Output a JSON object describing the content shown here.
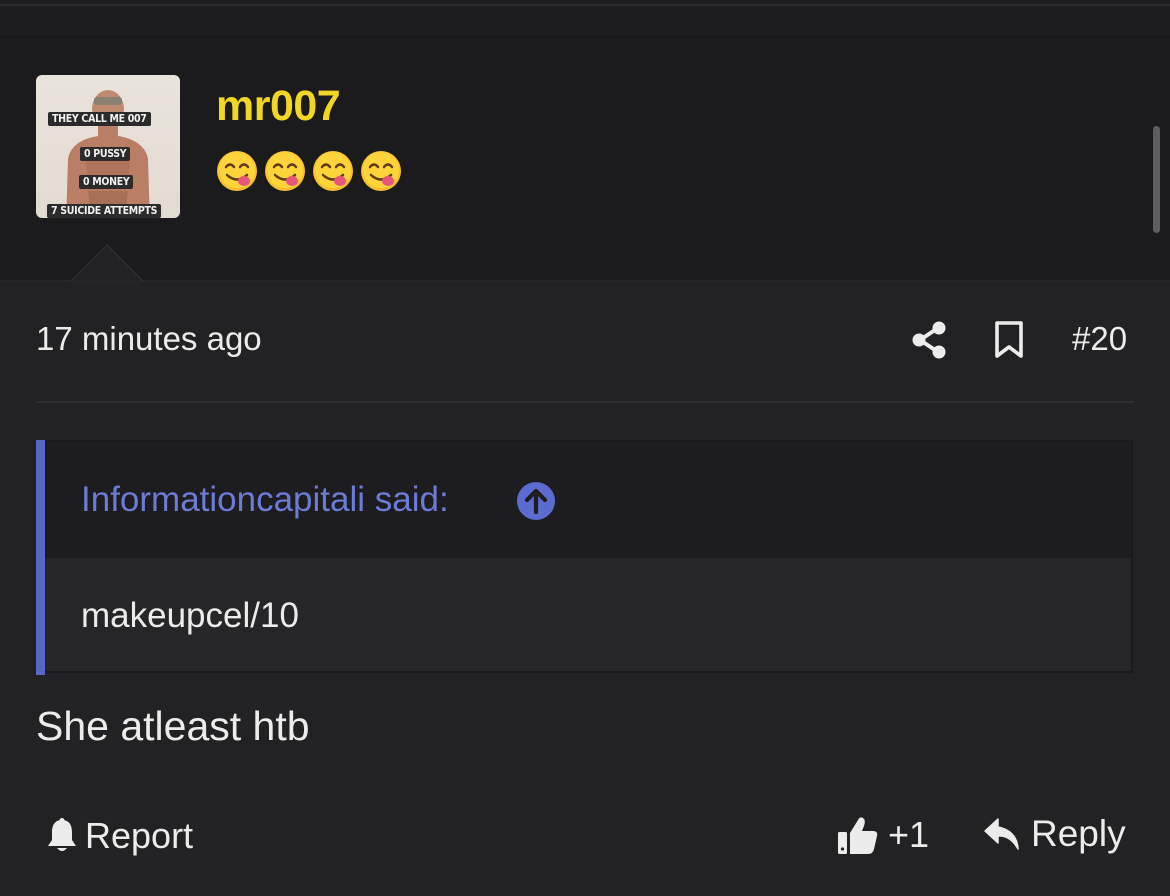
{
  "post": {
    "avatar": {
      "captions": [
        "THEY CALL ME 007",
        "0 PUSSY",
        "0 MONEY",
        "7 SUICIDE ATTEMPTS"
      ]
    },
    "username": "mr007",
    "user_title_emoji": [
      "😋",
      "😋",
      "😋",
      "😋"
    ],
    "timestamp": "17 minutes ago",
    "post_number": "#20",
    "quote": {
      "author": "Informationcapitali said:",
      "text": "makeupcel/10"
    },
    "body": "She atleast htb",
    "actions": {
      "report_label": "Report",
      "like_count": "+1",
      "reply_label": "Reply"
    }
  },
  "colors": {
    "background": "#222224",
    "header_background": "#1b1b1d",
    "username": "#f2d624",
    "quote_accent": "#5866c8",
    "quote_author": "#6b7bd6",
    "text": "#ececec"
  },
  "icons": [
    "share-icon",
    "bookmark-icon",
    "arrow-up-circle-icon",
    "bell-icon",
    "thumbs-up-icon",
    "reply-icon"
  ]
}
